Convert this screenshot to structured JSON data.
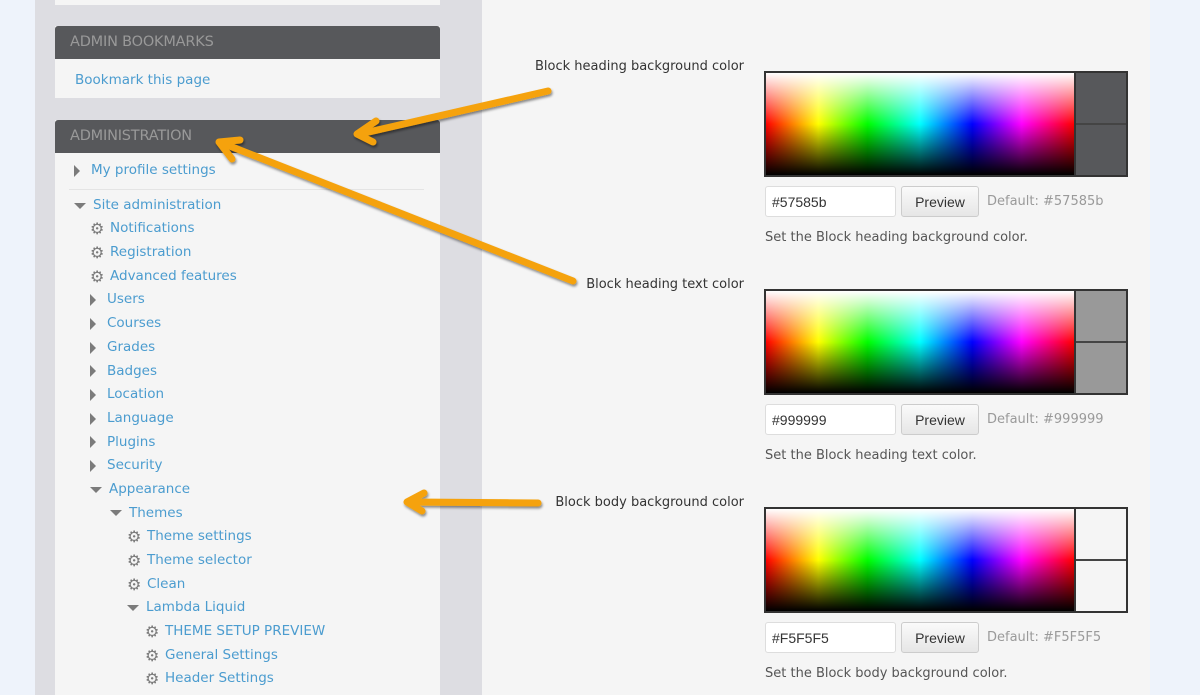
{
  "sidebar": {
    "bookmarks": {
      "title": "ADMIN BOOKMARKS",
      "link": "Bookmark this page"
    },
    "administration": {
      "title": "ADMINISTRATION",
      "items": [
        {
          "label": "My profile settings",
          "icon": "triangle-right-icon",
          "level": 0
        },
        {
          "label": "Site administration",
          "icon": "triangle-down-icon",
          "level": 0
        },
        {
          "label": "Notifications",
          "icon": "gear-icon",
          "level": 1
        },
        {
          "label": "Registration",
          "icon": "gear-icon",
          "level": 1
        },
        {
          "label": "Advanced features",
          "icon": "gear-icon",
          "level": 1
        },
        {
          "label": "Users",
          "icon": "triangle-right-icon",
          "level": 1
        },
        {
          "label": "Courses",
          "icon": "triangle-right-icon",
          "level": 1
        },
        {
          "label": "Grades",
          "icon": "triangle-right-icon",
          "level": 1
        },
        {
          "label": "Badges",
          "icon": "triangle-right-icon",
          "level": 1
        },
        {
          "label": "Location",
          "icon": "triangle-right-icon",
          "level": 1
        },
        {
          "label": "Language",
          "icon": "triangle-right-icon",
          "level": 1
        },
        {
          "label": "Plugins",
          "icon": "triangle-right-icon",
          "level": 1
        },
        {
          "label": "Security",
          "icon": "triangle-right-icon",
          "level": 1
        },
        {
          "label": "Appearance",
          "icon": "triangle-down-icon",
          "level": 1
        },
        {
          "label": "Themes",
          "icon": "triangle-down-icon",
          "level": 2
        },
        {
          "label": "Theme settings",
          "icon": "gear-icon",
          "level": 3
        },
        {
          "label": "Theme selector",
          "icon": "gear-icon",
          "level": 3
        },
        {
          "label": "Clean",
          "icon": "gear-icon",
          "level": 3
        },
        {
          "label": "Lambda Liquid",
          "icon": "triangle-down-icon",
          "level": 3
        },
        {
          "label": "THEME SETUP PREVIEW",
          "icon": "gear-icon",
          "level": 4
        },
        {
          "label": "General Settings",
          "icon": "gear-icon",
          "level": 4
        },
        {
          "label": "Header Settings",
          "icon": "gear-icon",
          "level": 4
        }
      ]
    }
  },
  "settings": [
    {
      "label": "Block heading background color",
      "value": "#57585b",
      "swatch": "#57585b",
      "button": "Preview",
      "default": "Default: #57585b",
      "description": "Set the Block heading background color."
    },
    {
      "label": "Block heading text color",
      "value": "#999999",
      "swatch": "#999999",
      "button": "Preview",
      "default": "Default: #999999",
      "description": "Set the Block heading text color."
    },
    {
      "label": "Block body background color",
      "value": "#F5F5F5",
      "swatch": "#F5F5F5",
      "button": "Preview",
      "default": "Default: #F5F5F5",
      "description": "Set the Block body background color."
    }
  ],
  "colors": {
    "link": "#4b9ccf",
    "annotation_arrow": "#f5a20a"
  }
}
